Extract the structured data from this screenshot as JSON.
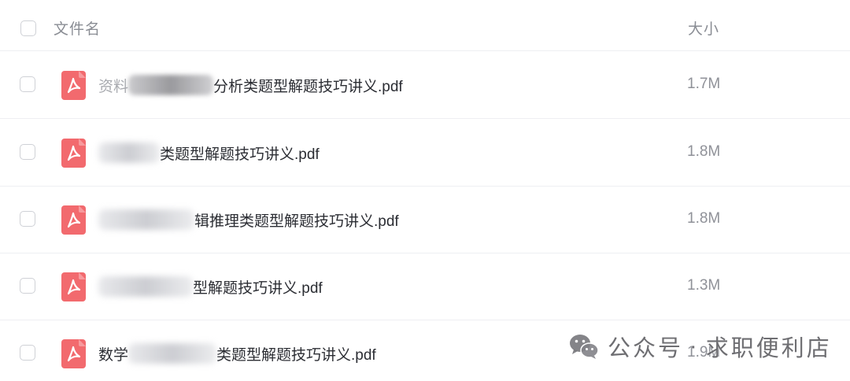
{
  "header": {
    "name_label": "文件名",
    "size_label": "大小"
  },
  "files": [
    {
      "prefix": "资料",
      "name": "分析类题型解题技巧讲义.pdf",
      "size": "1.7M",
      "icon": "pdf-icon"
    },
    {
      "prefix": "",
      "name": "类题型解题技巧讲义.pdf",
      "size": "1.8M",
      "icon": "pdf-icon"
    },
    {
      "prefix": "",
      "name": "辑推理类题型解题技巧讲义.pdf",
      "size": "1.8M",
      "icon": "pdf-icon"
    },
    {
      "prefix": "",
      "name": "型解题技巧讲义.pdf",
      "size": "1.3M",
      "icon": "pdf-icon"
    },
    {
      "prefix": "数学",
      "name": "类题型解题技巧讲义.pdf",
      "size": "1.9M",
      "icon": "pdf-icon"
    }
  ],
  "watermark": {
    "icon": "wechat-icon",
    "prefix": "公众号",
    "separator": "·",
    "name": "求职便利店"
  },
  "colors": {
    "pdf_red": "#f26a6e",
    "border": "#eeeff2",
    "text": "#2b2d33",
    "muted": "#8a8d94"
  }
}
